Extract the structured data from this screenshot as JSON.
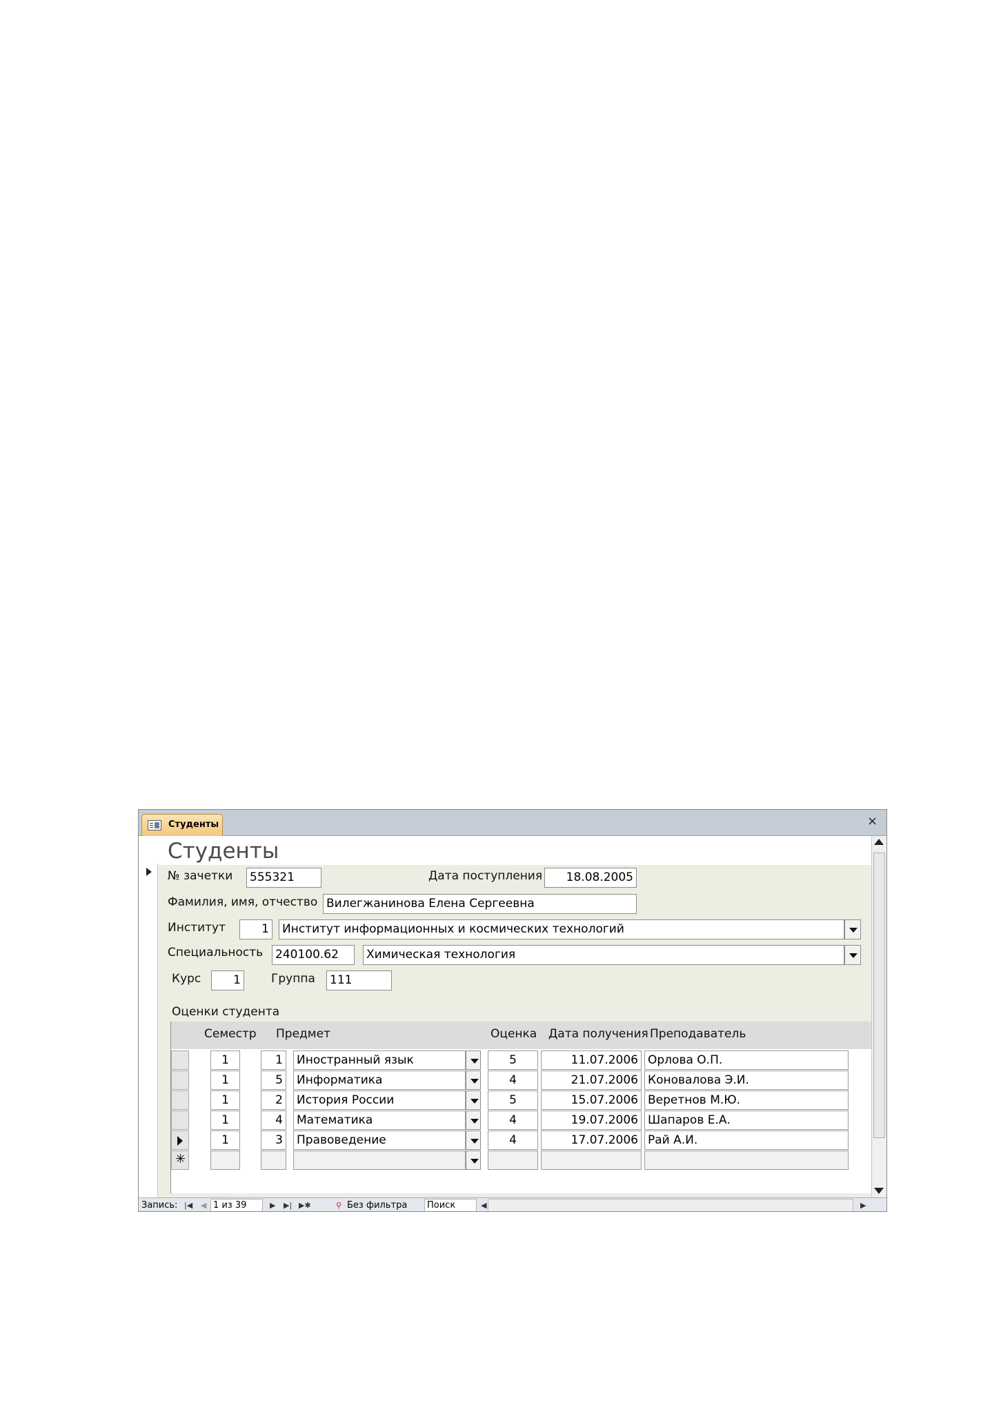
{
  "window": {
    "tab_label": "Студенты",
    "close_glyph": "×",
    "form_title": "Студенты"
  },
  "form": {
    "record_no_label": "№ зачетки",
    "record_no": "555321",
    "admission_date_label": "Дата поступления",
    "admission_date": "18.08.2005",
    "fio_label": "Фамилия, имя, отчество",
    "fio": "Вилегжанинова Елена Сергеевна",
    "institute_label": "Институт",
    "institute_code": "1",
    "institute_name": "Институт информационных и космических технологий",
    "specialty_label": "Специальность",
    "specialty_code": "240100.62",
    "specialty_name": "Химическая технология",
    "course_label": "Курс",
    "course": "1",
    "group_label": "Группа",
    "group": "111"
  },
  "subform": {
    "title": "Оценки студента",
    "columns": [
      "Семестр",
      "Предмет",
      "Оценка",
      "Дата получения",
      "Преподаватель"
    ],
    "rows": [
      {
        "semester": "1",
        "subject_code": "1",
        "subject": "Иностранный язык",
        "grade": "5",
        "date": "11.07.2006",
        "teacher": "Орлова О.П."
      },
      {
        "semester": "1",
        "subject_code": "5",
        "subject": "Информатика",
        "grade": "4",
        "date": "21.07.2006",
        "teacher": "Коновалова Э.И."
      },
      {
        "semester": "1",
        "subject_code": "2",
        "subject": "История России",
        "grade": "5",
        "date": "15.07.2006",
        "teacher": "Веретнов М.Ю."
      },
      {
        "semester": "1",
        "subject_code": "4",
        "subject": "Математика",
        "grade": "4",
        "date": "19.07.2006",
        "teacher": "Шапаров Е.А."
      },
      {
        "semester": "1",
        "subject_code": "3",
        "subject": "Правоведение",
        "grade": "4",
        "date": "17.07.2006",
        "teacher": "Рай А.И."
      }
    ],
    "new_row_marker": "✳"
  },
  "navigation": {
    "record_label": "Запись:",
    "position": "1 из 39",
    "filter_label": "Без фильтра",
    "search_label": "Поиск"
  }
}
